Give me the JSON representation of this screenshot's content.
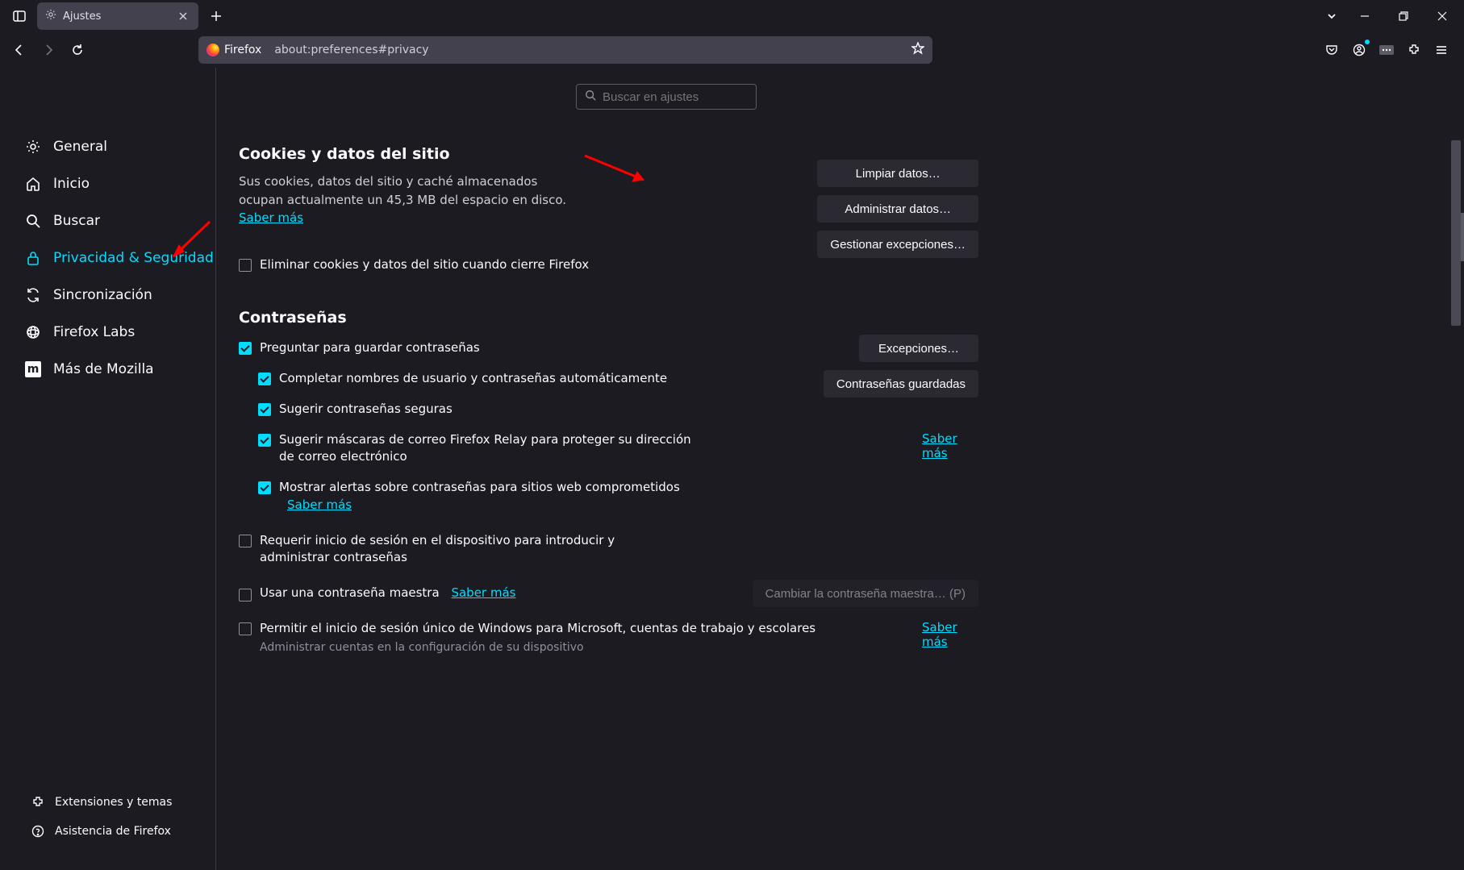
{
  "window": {
    "tab_title": "Ajustes"
  },
  "urlbar": {
    "identity": "Firefox",
    "url": "about:preferences#privacy"
  },
  "search": {
    "placeholder": "Buscar en ajustes"
  },
  "sidebar": {
    "items": [
      {
        "label": "General"
      },
      {
        "label": "Inicio"
      },
      {
        "label": "Buscar"
      },
      {
        "label": "Privacidad & Seguridad"
      },
      {
        "label": "Sincronización"
      },
      {
        "label": "Firefox Labs"
      },
      {
        "label": "Más de Mozilla"
      }
    ],
    "bottom": [
      {
        "label": "Extensiones y temas"
      },
      {
        "label": "Asistencia de Firefox"
      }
    ]
  },
  "cookies": {
    "title": "Cookies y datos del sitio",
    "desc_prefix": "Sus cookies, datos del sitio y caché almacenados ocupan actualmente un ",
    "size": "45,3 MB",
    "desc_suffix": " del espacio en disco. ",
    "learn_more": "Saber más",
    "delete_on_close": "Eliminar cookies y datos del sitio cuando cierre Firefox",
    "clear_btn": "Limpiar datos…",
    "manage_btn": "Administrar datos…",
    "exceptions_btn": "Gestionar excepciones…"
  },
  "passwords": {
    "title": "Contraseñas",
    "ask_save": "Preguntar para guardar contraseñas",
    "autofill": "Completar nombres de usuario y contraseñas automáticamente",
    "suggest_strong": "Sugerir contraseñas seguras",
    "relay": "Sugerir máscaras de correo Firefox Relay para proteger su dirección de correo electrónico",
    "relay_learn": "Saber más",
    "breach_alerts": "Mostrar alertas sobre contraseñas para sitios web comprometidos",
    "breach_learn": "Saber más",
    "require_login": "Requerir inicio de sesión en el dispositivo para introducir y administrar contraseñas",
    "master_pw": "Usar una contraseña maestra",
    "master_learn": "Saber más",
    "master_btn": "Cambiar la contraseña maestra… (P)",
    "sso": "Permitir el inicio de sesión único de Windows para Microsoft, cuentas de trabajo y escolares",
    "sso_learn": "Saber más",
    "sso_sub": "Administrar cuentas en la configuración de su dispositivo",
    "exceptions_btn": "Excepciones…",
    "saved_btn": "Contraseñas guardadas"
  }
}
